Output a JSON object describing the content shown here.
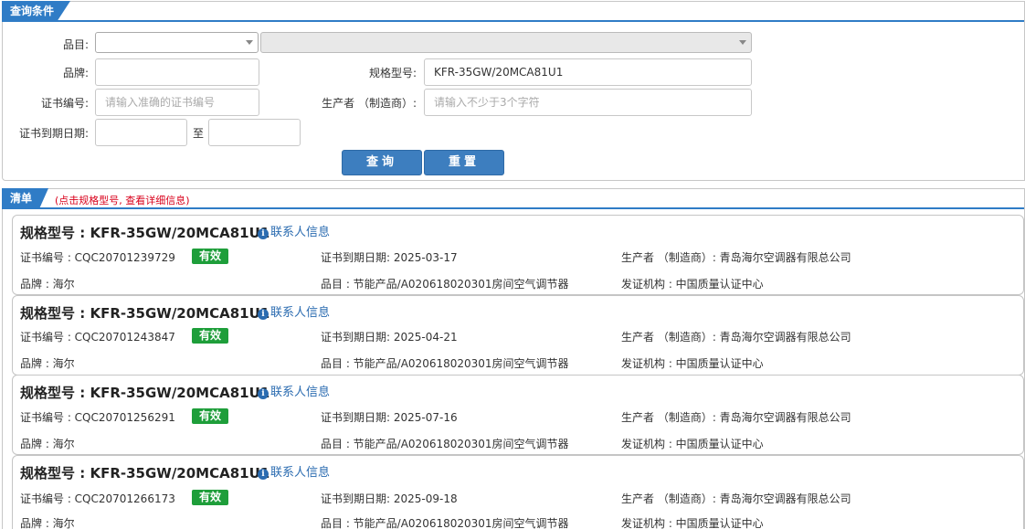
{
  "query": {
    "tab": "查询条件",
    "category_label": "品目:",
    "category_value": "",
    "subcategory_value": "",
    "brand_label": "品牌:",
    "brand_value": "",
    "model_label": "规格型号:",
    "model_value": "KFR-35GW/20MCA81U1",
    "cert_label": "证书编号:",
    "cert_placeholder": "请输入准确的证书编号",
    "maker_label": "生产者 （制造商）:",
    "maker_placeholder": "请输入不少于3个字符",
    "expiry_label": "证书到期日期:",
    "expiry_from": "",
    "expiry_to_label": "至",
    "expiry_to": "",
    "search_button": "查询",
    "reset_button": "重置"
  },
  "list": {
    "tab": "清单",
    "hint": "(点击规格型号, 查看详细信息)",
    "contact_label": "联系人信息",
    "contact_icon": "info-circle-icon",
    "items": [
      {
        "title": "规格型号 : KFR-35GW/20MCA81U1",
        "cert": "证书编号 : CQC20701239729",
        "status": "有效",
        "expiry": "证书到期日期: 2025-03-17",
        "maker": "生产者 （制造商）: 青岛海尔空调器有限总公司",
        "brand": "品牌 : 海尔",
        "category": "品目 : 节能产品/A020618020301房间空气调节器",
        "issuer": "发证机构 : 中国质量认证中心"
      },
      {
        "title": "规格型号 : KFR-35GW/20MCA81U1",
        "cert": "证书编号 : CQC20701243847",
        "status": "有效",
        "expiry": "证书到期日期: 2025-04-21",
        "maker": "生产者 （制造商）: 青岛海尔空调器有限总公司",
        "brand": "品牌 : 海尔",
        "category": "品目 : 节能产品/A020618020301房间空气调节器",
        "issuer": "发证机构 : 中国质量认证中心"
      },
      {
        "title": "规格型号 : KFR-35GW/20MCA81U1",
        "cert": "证书编号 : CQC20701256291",
        "status": "有效",
        "expiry": "证书到期日期: 2025-07-16",
        "maker": "生产者 （制造商）: 青岛海尔空调器有限总公司",
        "brand": "品牌 : 海尔",
        "category": "品目 : 节能产品/A020618020301房间空气调节器",
        "issuer": "发证机构 : 中国质量认证中心"
      },
      {
        "title": "规格型号 : KFR-35GW/20MCA81U1",
        "cert": "证书编号 : CQC20701266173",
        "status": "有效",
        "expiry": "证书到期日期: 2025-09-18",
        "maker": "生产者 （制造商）: 青岛海尔空调器有限总公司",
        "brand": "品牌 : 海尔",
        "category": "品目 : 节能产品/A020618020301房间空气调节器",
        "issuer": "发证机构 : 中国质量认证中心"
      }
    ]
  },
  "colors": {
    "accent": "#2f7cc6",
    "button": "#3d7ebf",
    "valid_badge": "#1e9e3a",
    "hint": "#d9001b",
    "link": "#2a6bb0"
  }
}
